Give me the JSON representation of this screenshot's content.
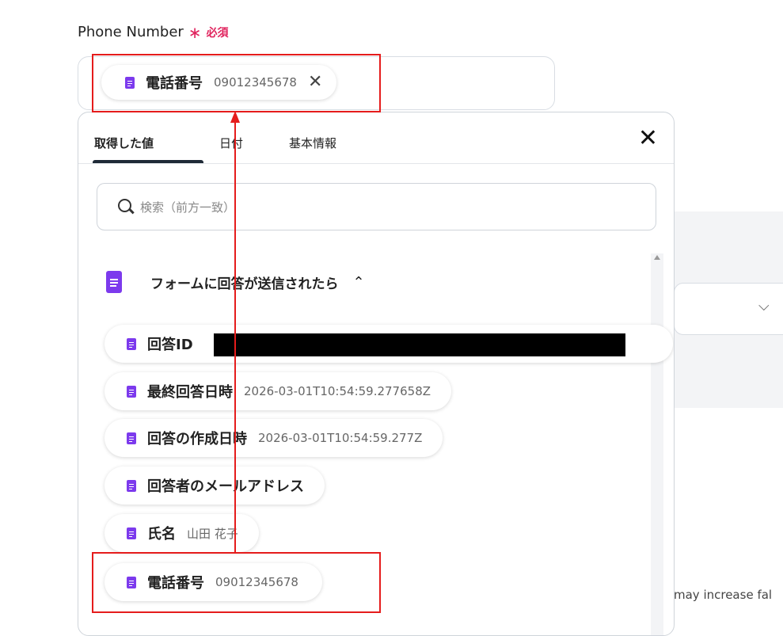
{
  "field": {
    "label": "Phone Number",
    "required_mark": "∗",
    "required_text": "必須",
    "chip": {
      "label": "電話番号",
      "value": "09012345678"
    }
  },
  "panel": {
    "tabs": [
      "取得した値",
      "日付",
      "基本情報"
    ],
    "active_tab": 0,
    "search_placeholder": "検索（前方一致）",
    "group": {
      "title": "フォームに回答が送信されたら",
      "items": [
        {
          "label": "回答ID",
          "value": ""
        },
        {
          "label": "最終回答日時",
          "value": "2026-03-01T10:54:59.277658Z"
        },
        {
          "label": "回答の作成日時",
          "value": "2026-03-01T10:54:59.277Z"
        },
        {
          "label": "回答者のメールアドレス",
          "value": ""
        },
        {
          "label": "氏名",
          "value": "山田 花子"
        },
        {
          "label": "電話番号",
          "value": "09012345678"
        }
      ]
    }
  },
  "background": {
    "hint_text": "may increase fal"
  },
  "colors": {
    "accent": "#7c3aed",
    "required": "#e0245e",
    "annotation": "#e51c1c"
  }
}
